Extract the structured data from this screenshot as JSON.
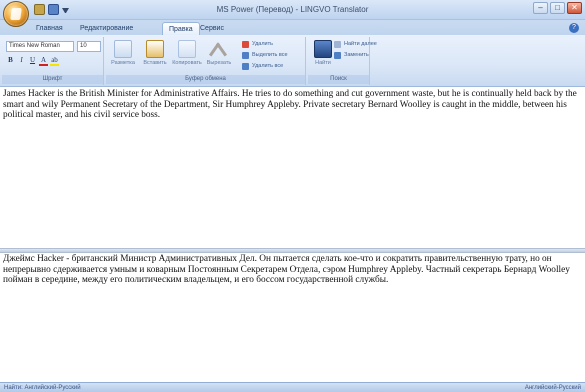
{
  "window": {
    "title": "MS Power (Перевод) - LINGVO Translator",
    "controls": [
      "–",
      "□",
      "✕"
    ]
  },
  "tabs": [
    {
      "label": "Главная",
      "active": false
    },
    {
      "label": "Редактирование",
      "active": false
    },
    {
      "label": "Правка",
      "active": true
    },
    {
      "label": "Сервис",
      "active": false
    }
  ],
  "ribbon": {
    "font": {
      "family": "Times New Roman",
      "size": "10",
      "format_buttons": [
        "B",
        "I",
        "U",
        "A",
        "ab"
      ],
      "label": "Шрифт"
    },
    "editing": {
      "buttons": [
        {
          "label": "Разметка",
          "icon": "pages-icon"
        },
        {
          "label": "Вставить",
          "icon": "paste-icon"
        },
        {
          "label": "Копировать",
          "icon": "copy-icon"
        },
        {
          "label": "Вырезать",
          "icon": "scissors-icon"
        }
      ],
      "small_items": [
        {
          "label": "Удалить",
          "icon": "delete-icon"
        },
        {
          "label": "Выделить все",
          "icon": "select-all-icon"
        },
        {
          "label": "Удалить все",
          "icon": "clear-all-icon"
        }
      ],
      "label": "Буфер обмена"
    },
    "find": {
      "button": {
        "label": "Найти",
        "icon": "binoculars-icon"
      },
      "small_items": [
        {
          "label": "Найти далее",
          "icon": "find-next-icon"
        },
        {
          "label": "Заменить",
          "icon": "replace-icon"
        }
      ],
      "label": "Поиск"
    }
  },
  "document": {
    "source_text": "James Hacker is the British Minister for Administrative Affairs. He tries to do something and cut government waste, but he is continually held back by the smart and wily Permanent Secretary of the Department, Sir Humphrey Appleby. Private secretary Bernard Woolley is caught in the middle, between his political master, and his civil service boss.",
    "translated_text": "Джеймс Hacker - британский Министр Административных Дел. Он пытается сделать кое-что и сократить правительственную трату, но он непрерывно сдерживается умным и коварным Постоянным Секретарем Отдела, сэром Humphrey Appleby. Частный секретарь Бернард Woolley пойман в середине, между его политическим владельцем, и его боссом государственной службы."
  },
  "status": {
    "left": "Найти: Английский-Русский",
    "right": "Английский-Русский"
  },
  "colors": {
    "ribbon_bg": "#dbe7f7",
    "title_bg": "#bdd3ef",
    "status_bg": "#b2c9e8"
  }
}
